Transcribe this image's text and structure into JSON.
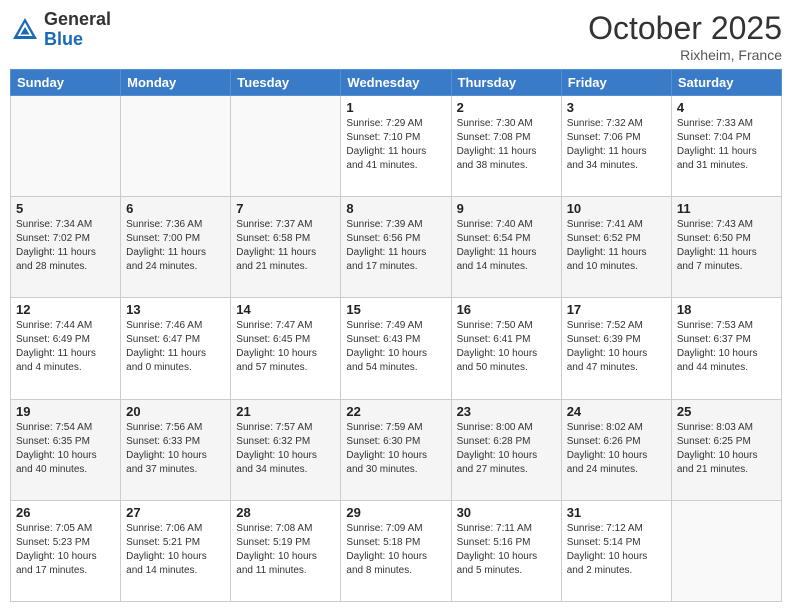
{
  "logo": {
    "general": "General",
    "blue": "Blue"
  },
  "header": {
    "month_year": "October 2025",
    "location": "Rixheim, France"
  },
  "weekdays": [
    "Sunday",
    "Monday",
    "Tuesday",
    "Wednesday",
    "Thursday",
    "Friday",
    "Saturday"
  ],
  "weeks": [
    [
      {
        "day": "",
        "sunrise": "",
        "sunset": "",
        "daylight": ""
      },
      {
        "day": "",
        "sunrise": "",
        "sunset": "",
        "daylight": ""
      },
      {
        "day": "",
        "sunrise": "",
        "sunset": "",
        "daylight": ""
      },
      {
        "day": "1",
        "sunrise": "Sunrise: 7:29 AM",
        "sunset": "Sunset: 7:10 PM",
        "daylight": "Daylight: 11 hours and 41 minutes."
      },
      {
        "day": "2",
        "sunrise": "Sunrise: 7:30 AM",
        "sunset": "Sunset: 7:08 PM",
        "daylight": "Daylight: 11 hours and 38 minutes."
      },
      {
        "day": "3",
        "sunrise": "Sunrise: 7:32 AM",
        "sunset": "Sunset: 7:06 PM",
        "daylight": "Daylight: 11 hours and 34 minutes."
      },
      {
        "day": "4",
        "sunrise": "Sunrise: 7:33 AM",
        "sunset": "Sunset: 7:04 PM",
        "daylight": "Daylight: 11 hours and 31 minutes."
      }
    ],
    [
      {
        "day": "5",
        "sunrise": "Sunrise: 7:34 AM",
        "sunset": "Sunset: 7:02 PM",
        "daylight": "Daylight: 11 hours and 28 minutes."
      },
      {
        "day": "6",
        "sunrise": "Sunrise: 7:36 AM",
        "sunset": "Sunset: 7:00 PM",
        "daylight": "Daylight: 11 hours and 24 minutes."
      },
      {
        "day": "7",
        "sunrise": "Sunrise: 7:37 AM",
        "sunset": "Sunset: 6:58 PM",
        "daylight": "Daylight: 11 hours and 21 minutes."
      },
      {
        "day": "8",
        "sunrise": "Sunrise: 7:39 AM",
        "sunset": "Sunset: 6:56 PM",
        "daylight": "Daylight: 11 hours and 17 minutes."
      },
      {
        "day": "9",
        "sunrise": "Sunrise: 7:40 AM",
        "sunset": "Sunset: 6:54 PM",
        "daylight": "Daylight: 11 hours and 14 minutes."
      },
      {
        "day": "10",
        "sunrise": "Sunrise: 7:41 AM",
        "sunset": "Sunset: 6:52 PM",
        "daylight": "Daylight: 11 hours and 10 minutes."
      },
      {
        "day": "11",
        "sunrise": "Sunrise: 7:43 AM",
        "sunset": "Sunset: 6:50 PM",
        "daylight": "Daylight: 11 hours and 7 minutes."
      }
    ],
    [
      {
        "day": "12",
        "sunrise": "Sunrise: 7:44 AM",
        "sunset": "Sunset: 6:49 PM",
        "daylight": "Daylight: 11 hours and 4 minutes."
      },
      {
        "day": "13",
        "sunrise": "Sunrise: 7:46 AM",
        "sunset": "Sunset: 6:47 PM",
        "daylight": "Daylight: 11 hours and 0 minutes."
      },
      {
        "day": "14",
        "sunrise": "Sunrise: 7:47 AM",
        "sunset": "Sunset: 6:45 PM",
        "daylight": "Daylight: 10 hours and 57 minutes."
      },
      {
        "day": "15",
        "sunrise": "Sunrise: 7:49 AM",
        "sunset": "Sunset: 6:43 PM",
        "daylight": "Daylight: 10 hours and 54 minutes."
      },
      {
        "day": "16",
        "sunrise": "Sunrise: 7:50 AM",
        "sunset": "Sunset: 6:41 PM",
        "daylight": "Daylight: 10 hours and 50 minutes."
      },
      {
        "day": "17",
        "sunrise": "Sunrise: 7:52 AM",
        "sunset": "Sunset: 6:39 PM",
        "daylight": "Daylight: 10 hours and 47 minutes."
      },
      {
        "day": "18",
        "sunrise": "Sunrise: 7:53 AM",
        "sunset": "Sunset: 6:37 PM",
        "daylight": "Daylight: 10 hours and 44 minutes."
      }
    ],
    [
      {
        "day": "19",
        "sunrise": "Sunrise: 7:54 AM",
        "sunset": "Sunset: 6:35 PM",
        "daylight": "Daylight: 10 hours and 40 minutes."
      },
      {
        "day": "20",
        "sunrise": "Sunrise: 7:56 AM",
        "sunset": "Sunset: 6:33 PM",
        "daylight": "Daylight: 10 hours and 37 minutes."
      },
      {
        "day": "21",
        "sunrise": "Sunrise: 7:57 AM",
        "sunset": "Sunset: 6:32 PM",
        "daylight": "Daylight: 10 hours and 34 minutes."
      },
      {
        "day": "22",
        "sunrise": "Sunrise: 7:59 AM",
        "sunset": "Sunset: 6:30 PM",
        "daylight": "Daylight: 10 hours and 30 minutes."
      },
      {
        "day": "23",
        "sunrise": "Sunrise: 8:00 AM",
        "sunset": "Sunset: 6:28 PM",
        "daylight": "Daylight: 10 hours and 27 minutes."
      },
      {
        "day": "24",
        "sunrise": "Sunrise: 8:02 AM",
        "sunset": "Sunset: 6:26 PM",
        "daylight": "Daylight: 10 hours and 24 minutes."
      },
      {
        "day": "25",
        "sunrise": "Sunrise: 8:03 AM",
        "sunset": "Sunset: 6:25 PM",
        "daylight": "Daylight: 10 hours and 21 minutes."
      }
    ],
    [
      {
        "day": "26",
        "sunrise": "Sunrise: 7:05 AM",
        "sunset": "Sunset: 5:23 PM",
        "daylight": "Daylight: 10 hours and 17 minutes."
      },
      {
        "day": "27",
        "sunrise": "Sunrise: 7:06 AM",
        "sunset": "Sunset: 5:21 PM",
        "daylight": "Daylight: 10 hours and 14 minutes."
      },
      {
        "day": "28",
        "sunrise": "Sunrise: 7:08 AM",
        "sunset": "Sunset: 5:19 PM",
        "daylight": "Daylight: 10 hours and 11 minutes."
      },
      {
        "day": "29",
        "sunrise": "Sunrise: 7:09 AM",
        "sunset": "Sunset: 5:18 PM",
        "daylight": "Daylight: 10 hours and 8 minutes."
      },
      {
        "day": "30",
        "sunrise": "Sunrise: 7:11 AM",
        "sunset": "Sunset: 5:16 PM",
        "daylight": "Daylight: 10 hours and 5 minutes."
      },
      {
        "day": "31",
        "sunrise": "Sunrise: 7:12 AM",
        "sunset": "Sunset: 5:14 PM",
        "daylight": "Daylight: 10 hours and 2 minutes."
      },
      {
        "day": "",
        "sunrise": "",
        "sunset": "",
        "daylight": ""
      }
    ]
  ]
}
